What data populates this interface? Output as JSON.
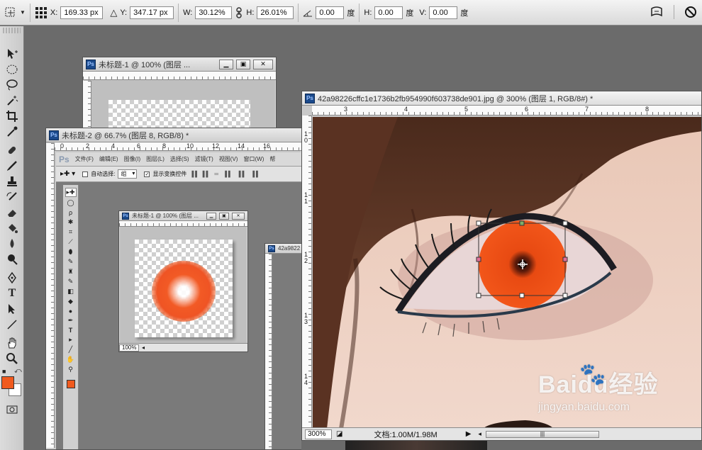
{
  "options_bar": {
    "x_label": "X:",
    "x_value": "169.33 px",
    "y_label": "Y:",
    "y_value": "347.17 px",
    "w_label": "W:",
    "w_value": "30.12%",
    "h_label": "H:",
    "h_value": "26.01%",
    "angle_value": "0.00",
    "angle_unit": "度",
    "hskew_label": "H:",
    "hskew_value": "0.00",
    "hskew_unit": "度",
    "vskew_label": "V:",
    "vskew_value": "0.00",
    "vskew_unit": "度",
    "icons": [
      "move-transform-icon",
      "reference-point-icon",
      "link-icon",
      "warp-icon",
      "cancel-transform-icon"
    ]
  },
  "toolbox": {
    "tools": [
      "move-tool-icon",
      "marquee-tool-icon",
      "lasso-tool-icon",
      "magic-wand-icon",
      "crop-tool-icon",
      "eyedropper-icon",
      "healing-brush-icon",
      "brush-tool-icon",
      "clone-stamp-icon",
      "history-brush-icon",
      "eraser-icon",
      "paint-bucket-icon",
      "blur-tool-icon",
      "dodge-tool-icon",
      "pen-tool-icon",
      "type-tool-icon",
      "path-selection-icon",
      "line-tool-icon",
      "hand-tool-icon",
      "zoom-tool-icon"
    ],
    "foreground_color": "#f05a1e",
    "background_color": "#ffffff"
  },
  "windows": {
    "win1": {
      "title": "未标题-1 @ 100% (图层 ...",
      "badge": "Ps"
    },
    "win2": {
      "title": "未标题-2 @ 66.7% (图层 8, RGB/8) *",
      "badge": "Ps",
      "ruler_marks": [
        "0",
        "2",
        "4",
        "6",
        "8",
        "10",
        "12",
        "14",
        "16"
      ],
      "menu": [
        "文件(F)",
        "编辑(E)",
        "图像(I)",
        "图层(L)",
        "选择(S)",
        "滤镜(T)",
        "视图(V)",
        "窗口(W)",
        "帮"
      ],
      "auto_select_label": "自动选择:",
      "auto_select_value": "组",
      "show_transform_label": "显示变换控件",
      "inner_window": {
        "title": "未标题-1 @ 100% (图层 ...",
        "zoom": "100%"
      },
      "inner_window2": {
        "title": "42a9822"
      }
    },
    "win3": {
      "title": "42a98226cffc1e1736b2fb954990f603738de901.jpg @ 300% (图层 1, RGB/8#) *",
      "badge": "Ps",
      "ruler_marks": [
        "3",
        "4",
        "5",
        "6",
        "7",
        "8"
      ],
      "vruler_marks": [
        "1\n0",
        "1\n1",
        "1\n2",
        "1\n3",
        "1\n4"
      ],
      "zoom": "300%",
      "doc_info": "文档:1.00M/1.98M",
      "watermark_brand": "Baidu经验",
      "watermark_url": "jingyan.baidu.com"
    }
  },
  "colors": {
    "accent_orange": "#f05a1e",
    "panel_bg": "#6b6b6b"
  }
}
